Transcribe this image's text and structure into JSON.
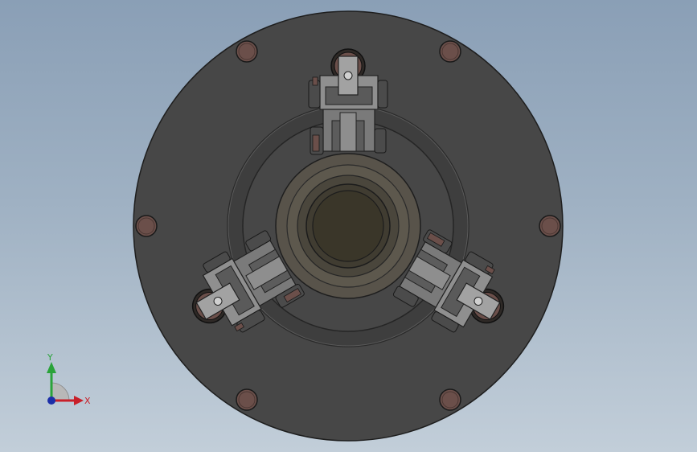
{
  "viewport": {
    "background_top": "#8a9fb6",
    "background_bottom": "#c2ced9"
  },
  "model": {
    "flange_color": "#474747",
    "ring_color": "#3f3f3f",
    "hub_color": "#5b5549",
    "bore_color": "#3a3629",
    "bolt_color": "#6b4f4a",
    "bracket_color": "#8c8c8c",
    "bolt_count": 6,
    "arm_count": 3
  },
  "triad": {
    "x_label": "X",
    "y_label": "Y",
    "x_color": "#c8202a",
    "y_color": "#2aa33a",
    "z_color": "#1c2ea8"
  }
}
